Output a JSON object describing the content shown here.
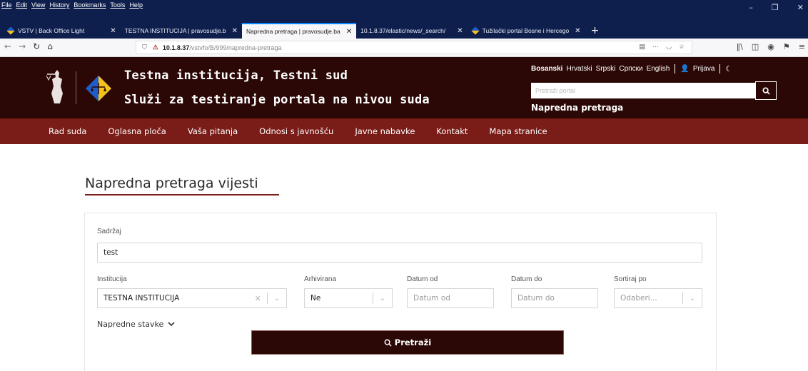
{
  "browser": {
    "menus": [
      "File",
      "Edit",
      "View",
      "History",
      "Bookmarks",
      "Tools",
      "Help"
    ],
    "tabs": [
      {
        "label": "VSTV | Back Office Light",
        "active": false
      },
      {
        "label": "TESTNA INSTITUCIJA | pravosudje.b",
        "active": false
      },
      {
        "label": "Napredna pretraga | pravosudje.ba",
        "active": true
      },
      {
        "label": "10.1.8.37/elastic/news/_search/",
        "active": false
      },
      {
        "label": "Tužilački portal Bosne i Hercego",
        "active": false
      }
    ],
    "url_host": "10.1.8.37",
    "url_path": "/vstvfo/B/999/napredna-pretraga"
  },
  "header": {
    "title": "Testna institucija, Testni sud",
    "subtitle": "Služi za testiranje portala na nivou suda",
    "languages": [
      "Bosanski",
      "Hrvatski",
      "Srpski",
      "Српски",
      "English"
    ],
    "active_language": "Bosanski",
    "login": "Prijava",
    "search_placeholder": "Pretraži portal",
    "advanced_search": "Napredna pretraga"
  },
  "nav": [
    "Rad suda",
    "Oglasna ploča",
    "Vaša pitanja",
    "Odnosi s javnošću",
    "Javne nabavke",
    "Kontakt",
    "Mapa stranice"
  ],
  "page": {
    "title": "Napredna pretraga vijesti"
  },
  "form": {
    "content_label": "Sadržaj",
    "content_value": "test",
    "institution_label": "Institucija",
    "institution_value": "TESTNA INSTITUCIJA",
    "archived_label": "Arhivirana",
    "archived_value": "Ne",
    "date_from_label": "Datum od",
    "date_from_placeholder": "Datum od",
    "date_to_label": "Datum do",
    "date_to_placeholder": "Datum do",
    "sort_label": "Sortiraj po",
    "sort_placeholder": "Odaberi...",
    "advanced_items": "Napredne stavke",
    "submit": "Pretraži"
  }
}
